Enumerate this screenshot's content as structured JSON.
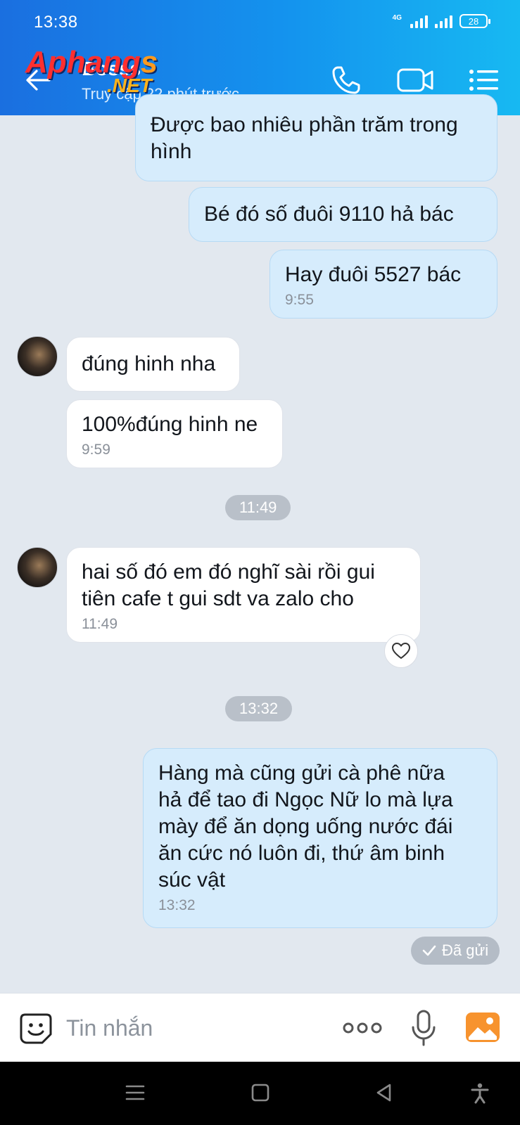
{
  "status_bar": {
    "time": "13:38",
    "network": "4G",
    "battery": "28"
  },
  "header": {
    "watermark_main": "Aphang",
    "watermark_s": "s",
    "watermark_net": ".NET",
    "contact_name": "Bosss",
    "last_seen": "Truy cập 22 phút trước",
    "icons": [
      "back-arrow",
      "phone",
      "video",
      "menu"
    ],
    "colors": {
      "gradient_start": "#1a6fe0",
      "gradient_end": "#17b9f2"
    }
  },
  "messages": [
    {
      "side": "out",
      "text_lines": [
        "Được bao nhiêu phần trăm trong",
        "hình"
      ]
    },
    {
      "side": "out",
      "text_lines": [
        "Bé đó số đuôi 9110 hả bác"
      ]
    },
    {
      "side": "out",
      "text_lines": [
        "Hay đuôi 5527 bác"
      ],
      "time": "9:55"
    },
    {
      "side": "in",
      "text_lines": [
        "đúng hinh nha"
      ]
    },
    {
      "side": "in",
      "text_lines": [
        "100%đúng hinh ne"
      ],
      "time": "9:59"
    },
    {
      "side": "in",
      "text_lines": [
        "hai số đó em đó nghĩ sài rồi gui",
        "tiên cafe t gui sdt va zalo cho"
      ],
      "time": "11:49"
    },
    {
      "side": "out",
      "text_lines": [
        "Hàng mà cũng gửi cà phê nữa",
        "hả để tao đi Ngọc Nữ lo mà lựa",
        "mày để ăn dọng uống nước đái",
        "ăn cức nó luôn đi, thứ âm binh",
        "súc vật"
      ],
      "time": "13:32"
    }
  ],
  "time_separators": [
    "11:49",
    "13:32"
  ],
  "status": {
    "sent_label": "Đã gửi"
  },
  "input": {
    "placeholder": "Tin nhắn"
  },
  "nav": {
    "icons": [
      "recents",
      "home",
      "back",
      "accessibility"
    ]
  }
}
